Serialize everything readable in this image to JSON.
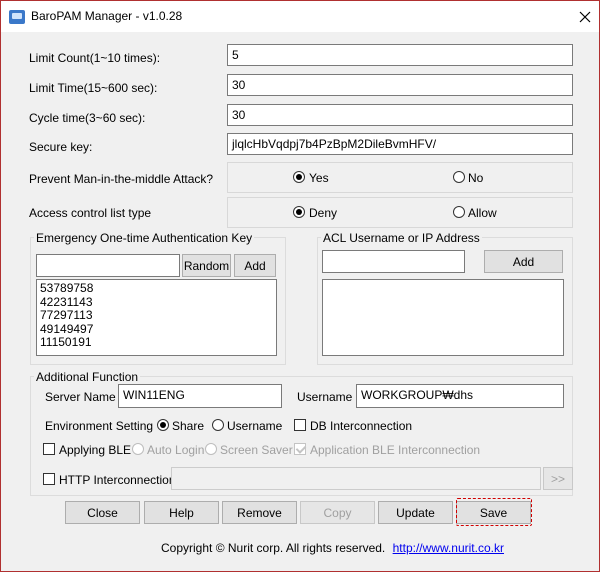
{
  "window": {
    "title": "BaroPAM Manager - v1.0.28"
  },
  "settings": {
    "limit_count_label": "Limit Count(1~10 times):",
    "limit_count_value": "5",
    "limit_time_label": "Limit Time(15~600 sec):",
    "limit_time_value": "30",
    "cycle_time_label": "Cycle time(3~60 sec):",
    "cycle_time_value": "30",
    "secure_key_label": "Secure key:",
    "secure_key_value": "jlqlcHbVqdpj7b4PzBpM2DileBvmHFV/",
    "mitm_label": "Prevent Man-in-the-middle Attack?",
    "mitm_yes": "Yes",
    "mitm_no": "No",
    "acl_type_label": "Access control list type",
    "acl_deny": "Deny",
    "acl_allow": "Allow"
  },
  "emergency": {
    "title": "Emergency One-time Authentication Key",
    "input_value": "",
    "random_label": "Random",
    "add_label": "Add",
    "keys": [
      "53789758",
      "42231143",
      "77297113",
      "49149497",
      "11150191"
    ]
  },
  "acl": {
    "title": "ACL Username or IP Address",
    "input_value": "",
    "add_label": "Add"
  },
  "additional": {
    "title": "Additional Function",
    "server_name_label": "Server Name",
    "server_name_value": "WIN11ENG",
    "username_label": "Username",
    "username_value": "WORKGROUP₩dhs",
    "env_label": "Environment Setting",
    "share_label": "Share",
    "username_option_label": "Username",
    "db_label": "DB Interconnection",
    "applying_ble_label": "Applying BLE",
    "auto_login_label": "Auto Login",
    "screen_saver_label": "Screen Saver",
    "app_ble_label": "Application BLE Interconnection",
    "http_label": "HTTP Interconnection",
    "http_value": "",
    "http_go_label": ">>"
  },
  "buttons": {
    "close": "Close",
    "help": "Help",
    "remove": "Remove",
    "copy": "Copy",
    "update": "Update",
    "save": "Save"
  },
  "footer": {
    "copyright": "Copyright © Nurit corp. All rights reserved.",
    "link": "http://www.nurit.co.kr"
  },
  "colors": {
    "highlight": "#d00000",
    "window_bg": "#f0f0f0",
    "link": "#0000ee"
  }
}
